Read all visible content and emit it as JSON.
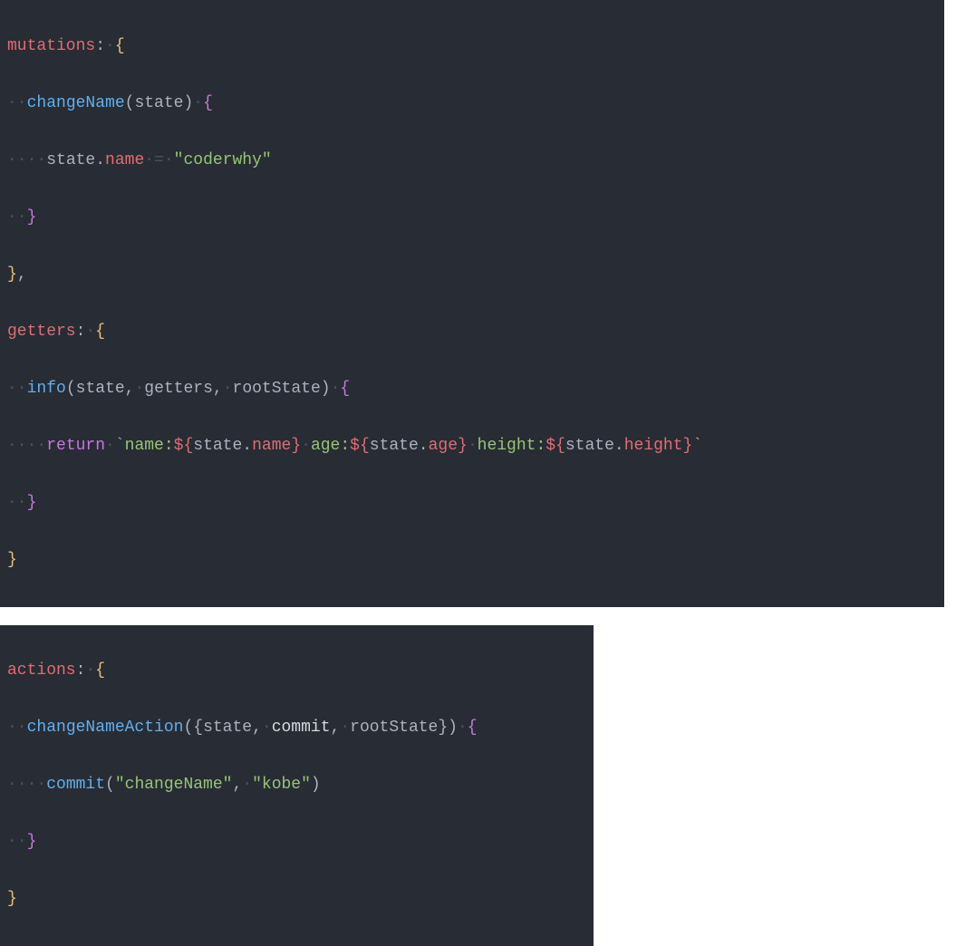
{
  "block1": {
    "line1": {
      "k_mutations": "mutations",
      "colon": ":",
      "brace": "{"
    },
    "line2": {
      "indent": "··",
      "fn": "changeName",
      "lp": "(",
      "arg": "state",
      "rp": ")",
      "brace": "{"
    },
    "line3": {
      "indent": "····",
      "obj": "state",
      "dot": ".",
      "prop": "name",
      "sp_eq": "·=·",
      "str": "\"coderwhy\""
    },
    "line4": {
      "indent": "··",
      "brace": "}"
    },
    "line5": {
      "brace": "}",
      "comma": ","
    },
    "line6": {
      "k_getters": "getters",
      "colon": ":",
      "brace": "{"
    },
    "line7": {
      "indent": "··",
      "fn": "info",
      "lp": "(",
      "a1": "state",
      "c1": ",",
      "a2": "getters",
      "c2": ",",
      "a3": "rootState",
      "rp": ")",
      "brace": "{"
    },
    "line8": {
      "indent": "····",
      "ret": "return",
      "bt1": "`",
      "t1": "name:",
      "d1a": "${",
      "o1": "state",
      "dot1": ".",
      "p1": "name",
      "d1b": "}",
      "sp1": "·",
      "t2": "age:",
      "d2a": "${",
      "o2": "state",
      "dot2": ".",
      "p2": "age",
      "d2b": "}",
      "sp2": "·",
      "t3": "height:",
      "d3a": "${",
      "o3": "state",
      "dot3": ".",
      "p3": "height",
      "d3b": "}",
      "bt2": "`"
    },
    "line9": {
      "indent": "··",
      "brace": "}"
    },
    "line10": {
      "brace": "}"
    }
  },
  "block2": {
    "line1": {
      "k_actions": "actions",
      "colon": ":",
      "brace": "{"
    },
    "line2": {
      "indent": "··",
      "fn": "changeNameAction",
      "lp": "(",
      "db1": "{",
      "a1": "state",
      "c1": ",",
      "a2": "commit",
      "c2": ",",
      "a3": "rootState",
      "db2": "}",
      "rp": ")",
      "brace": "{"
    },
    "line3": {
      "indent": "····",
      "fn": "commit",
      "lp": "(",
      "s1": "\"changeName\"",
      "c": ",",
      "s2": "\"kobe\"",
      "rp": ")"
    },
    "line4": {
      "indent": "··",
      "brace": "}"
    },
    "line5": {
      "brace": "}"
    }
  }
}
